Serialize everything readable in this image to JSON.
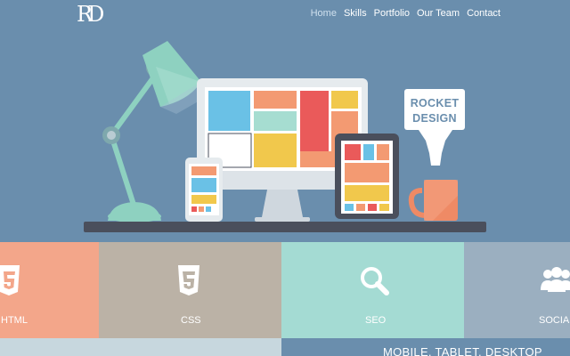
{
  "header": {
    "logo": "RD",
    "nav": [
      "Home",
      "Skills",
      "Portfolio",
      "Our Team",
      "Contact"
    ],
    "active_nav": "Home"
  },
  "hero": {
    "sign_line1": "ROCKET",
    "sign_line2": "DESIGN"
  },
  "tiles": [
    {
      "label": "HTML",
      "icon": "html5-icon",
      "color": "#f3a68a"
    },
    {
      "label": "CSS",
      "icon": "css3-icon",
      "color": "#bbb2a6"
    },
    {
      "label": "SEO",
      "icon": "magnifier-icon",
      "color": "#a4dbd3"
    },
    {
      "label": "SOCIAL",
      "icon": "people-icon",
      "color": "#9bafc0"
    }
  ],
  "bottom": {
    "heading": "MOBILE, TABLET, DESKTOP"
  },
  "colors": {
    "background": "#6a8ead",
    "lamp": "#8ed1c0",
    "desk": "#4a4f5c"
  }
}
